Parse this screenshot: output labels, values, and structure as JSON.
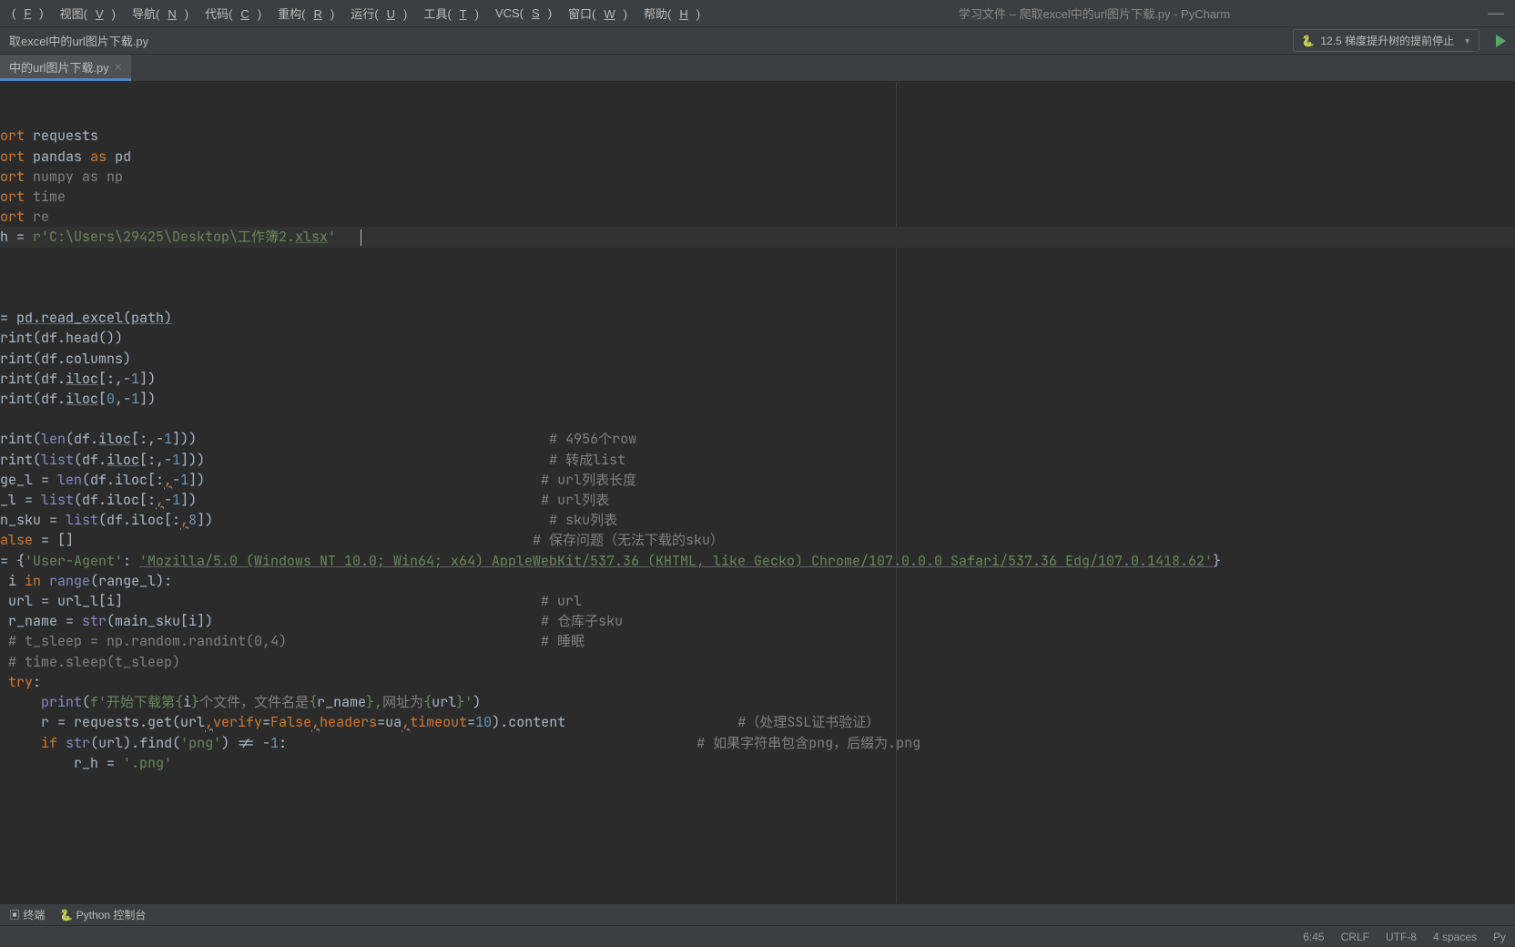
{
  "menubar": {
    "items": [
      {
        "label": "文件(F)",
        "u": "F"
      },
      {
        "label": "视图(V)",
        "u": "V"
      },
      {
        "label": "导航(N)",
        "u": "N"
      },
      {
        "label": "代码(C)",
        "u": "C"
      },
      {
        "label": "重构(R)",
        "u": "R"
      },
      {
        "label": "运行(U)",
        "u": "U"
      },
      {
        "label": "工具(T)",
        "u": "T"
      },
      {
        "label": "VCS(S)",
        "u": "S"
      },
      {
        "label": "窗口(W)",
        "u": "W"
      },
      {
        "label": "帮助(H)",
        "u": "H"
      }
    ],
    "title": "学习文件 – 爬取excel中的url图片下载.py - PyCharm"
  },
  "toolbar": {
    "breadcrumb": "取excel中的url图片下载.py",
    "runconfig": "12.5 梯度提升树的提前停止"
  },
  "tabs": {
    "active": "中的url图片下载.py"
  },
  "code": {
    "lines_html": [
      "<span class='kw'>ort</span> <span class='id'>requests</span>",
      "<span class='kw'>ort</span> <span class='id'>pandas</span> <span class='kw'>as</span> <span class='id'>pd</span>",
      "<span class='kw'>ort</span> <span class='comment'>numpy as np</span>",
      "<span class='kw'>ort</span> <span class='comment'>time</span>",
      "<span class='kw'>ort</span> <span class='comment'>re</span>",
      "<span class='id'>h</span> = <span class='str'>r'C:\\Users\\29425\\Desktop\\工作簿2.<span class='underline'>xlsx</span>'</span>   <span class='caret'></span>",
      "",
      "",
      "",
      "<span class='id'>= </span><span class='id underline'>pd.read_excel(path)</span>",
      "<span class='id'>rint(df.head())</span>",
      "<span class='id'>rint(df.columns)</span>",
      "<span class='id'>rint(df.<span class='underline'>iloc</span>[:,-<span class='num'>1</span>])</span>",
      "<span class='id'>rint(df.<span class='underline'>iloc</span>[<span class='num'>0</span>,-<span class='num'>1</span>])</span>",
      "",
      "<span class='id'>rint(<span class='builtin'>len</span>(df.<span class='underline'>iloc</span>[:,-<span class='num'>1</span>]))</span>                                           <span class='comment'># 4956个row</span>",
      "<span class='id'>rint(<span class='builtin'>list</span>(df.<span class='underline'>iloc</span>[:,-<span class='num'>1</span>]))</span>                                          <span class='comment'># 转成list</span>",
      "<span class='id'>ge_l = <span class='builtin'>len</span>(df.iloc[:<span class='kw' style='text-decoration:underline wavy #888;'>,</span>-<span class='num'>1</span>])</span>                                         <span class='comment'># url列表长度</span>",
      "<span class='id'>_l = <span class='builtin'>list</span>(df.iloc[:<span class='kw' style='text-decoration:underline wavy #888;'>,</span>-<span class='num'>1</span>])</span>                                          <span class='comment'># url列表</span>",
      "<span class='id'>n_sku = <span class='builtin'>list</span>(df.iloc[:<span class='kw' style='text-decoration:underline wavy #888;'>,</span><span class='num'>8</span>])</span>                                         <span class='comment'># sku列表</span>",
      "<span class='kw'>alse</span> = []                                                        <span class='comment'># 保存问题（无法下载的sku）</span>",
      "<span class='id'>= {<span class='str'>'User-Agent'</span>: <span class='str underline'>'Mozilla/5.0 (Windows NT 10.0; Win64; x64) AppleWebKit/537.36 (KHTML, like Gecko) Chrome/107.0.0.0 Safari/537.36 Edg/107.0.1418.62'</span>}</span>",
      "<span class='id'> i </span><span class='kw'>in</span> <span class='builtin'>range</span>(range_l):",
      "<span class='id'> url = url_l[i]</span>                                                   <span class='comment'># url</span>",
      "<span class='id'> r_name = <span class='builtin'>str</span>(main_sku[i])</span>                                        <span class='comment'># 仓库子sku</span>",
      "<span class='comment'> # t_sleep = np.random.randint(0,4)</span>                               <span class='comment'># 睡眠</span>",
      "<span class='comment'> # time.sleep(t_sleep)</span>",
      "<span class='kw'> try</span>:",
      "     <span class='builtin'>print</span>(<span class='str'>f'开始下载第{</span>i<span class='str'>}</span><span class='comment'>个文件，文件名是</span><span class='str'>{</span>r_name<span class='str'>},</span><span class='comment'>网址为</span><span class='str'>{</span>url<span class='str'>}'</span>)",
      "     r = requests.get(url<span class='kw' style='text-decoration:underline wavy #888;'>,</span><span class='param'>verify</span>=<span class='kw'>False</span><span class='kw' style='text-decoration:underline wavy #888;'>,</span><span class='param'>headers</span>=ua<span class='kw' style='text-decoration:underline wavy #888;'>,</span><span class='param'>timeout</span>=<span class='num'>10</span>).content                     <span class='comment'>#（处理SSL证书验证）</span>",
      "     <span class='kw'>if</span> <span class='builtin'>str</span>(url).find(<span class='str'>'png'</span>) != -<span class='num'>1</span>:                                                  <span class='comment'># 如果字符串包含png，后缀为.png</span>",
      "         r_h = <span class='str'>'.png'</span>"
    ],
    "highlighted_line_index": 5
  },
  "bottombar": {
    "terminal_label": "终端",
    "python_console_label": "Python 控制台"
  },
  "statusbar": {
    "pos": "6:45",
    "line_sep": "CRLF",
    "encoding": "UTF-8",
    "indent": "4 spaces",
    "interpreter": "Py"
  }
}
